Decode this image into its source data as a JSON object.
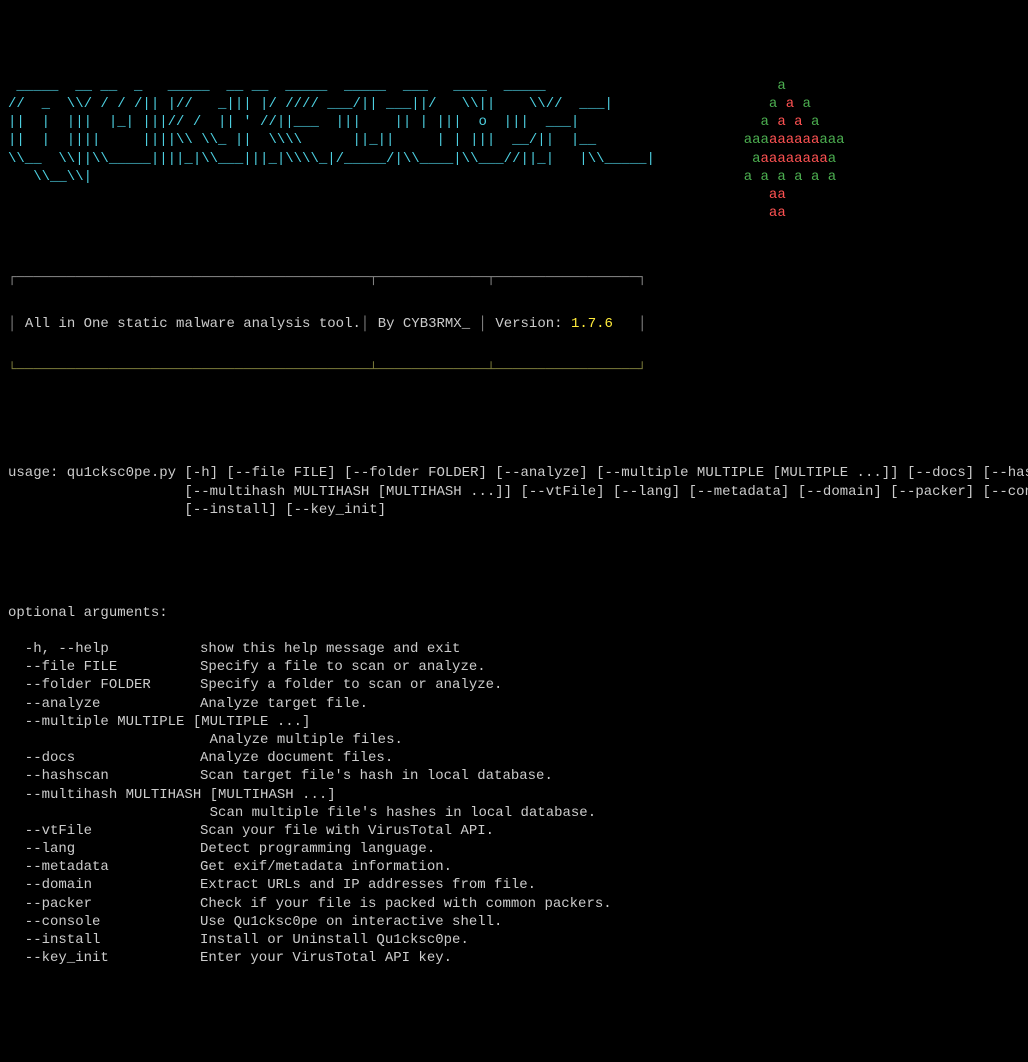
{
  "logo_lines": [
    " _____  __ __  _   _____  __ __  _____  _____  ___   ____  _____",
    "//  _  \\\\/ / / /|| |//   _||| |/ //// ___/|| ___||/   \\\\||    \\\\//  ___|",
    "||  |  |||  |_| |||// /  || ' //||___  |||    || | |||  o  |||  ___|",
    "||  |  ||||     ||||\\\\ \\\\_ ||  \\\\\\\\      ||_||     | | |||  __/||  |__",
    "\\\\__  \\\\||\\\\_____||||_|\\\\___|||_|\\\\\\\\_|/_____/|\\\\____|\\\\___//||_|   |\\\\_____|",
    "   \\\\__\\\\|"
  ],
  "tree_lines": [
    {
      "pre": "           ",
      "g1": "",
      "r": "",
      "g2": "a"
    },
    {
      "pre": "          ",
      "g1": "a ",
      "r": "a",
      "g2": " a"
    },
    {
      "pre": "         ",
      "g1": "a ",
      "r": "a a",
      "g2": " a"
    },
    {
      "pre": "       ",
      "g1": "aaa",
      "r": "aaaaaa",
      "g2": "aaa"
    },
    {
      "pre": "        ",
      "g1": "a",
      "r": "aaaaaaaa",
      "g2": "a"
    },
    {
      "pre": "       ",
      "g1": "a a a ",
      "r": "",
      "g2": "a a a"
    },
    {
      "pre": "          ",
      "g1": "",
      "r": "aa",
      "g2": ""
    },
    {
      "pre": "          ",
      "g1": "",
      "r": "aa",
      "g2": ""
    }
  ],
  "box": {
    "tagline": "All in One static malware analysis tool.",
    "by": "By CYB3RMX_",
    "version_label": "Version:",
    "version": "1.7.6"
  },
  "usage": [
    "usage: qu1cksc0pe.py [-h] [--file FILE] [--folder FOLDER] [--analyze] [--multiple MULTIPLE [MULTIPLE ...]] [--docs] [--hashscan]",
    "                     [--multihash MULTIHASH [MULTIHASH ...]] [--vtFile] [--lang] [--metadata] [--domain] [--packer] [--console]",
    "                     [--install] [--key_init]"
  ],
  "optional_header": "optional arguments:",
  "args": [
    {
      "flag": "  -h, --help",
      "desc": "show this help message and exit"
    },
    {
      "flag": "  --file FILE",
      "desc": "Specify a file to scan or analyze."
    },
    {
      "flag": "  --folder FOLDER",
      "desc": "Specify a folder to scan or analyze."
    },
    {
      "flag": "  --analyze",
      "desc": "Analyze target file."
    },
    {
      "flag": "  --multiple MULTIPLE [MULTIPLE ...]",
      "desc": "",
      "wrap": true
    },
    {
      "flag": "",
      "desc": "Analyze multiple files."
    },
    {
      "flag": "  --docs",
      "desc": "Analyze document files."
    },
    {
      "flag": "  --hashscan",
      "desc": "Scan target file's hash in local database."
    },
    {
      "flag": "  --multihash MULTIHASH [MULTIHASH ...]",
      "desc": "",
      "wrap": true
    },
    {
      "flag": "",
      "desc": "Scan multiple file's hashes in local database."
    },
    {
      "flag": "  --vtFile",
      "desc": "Scan your file with VirusTotal API."
    },
    {
      "flag": "  --lang",
      "desc": "Detect programming language."
    },
    {
      "flag": "  --metadata",
      "desc": "Get exif/metadata information."
    },
    {
      "flag": "  --domain",
      "desc": "Extract URLs and IP addresses from file."
    },
    {
      "flag": "  --packer",
      "desc": "Check if your file is packed with common packers."
    },
    {
      "flag": "  --console",
      "desc": "Use Qu1cksc0pe on interactive shell."
    },
    {
      "flag": "  --install",
      "desc": "Install or Uninstall Qu1cksc0pe."
    },
    {
      "flag": "  --key_init",
      "desc": "Enter your VirusTotal API key."
    }
  ]
}
